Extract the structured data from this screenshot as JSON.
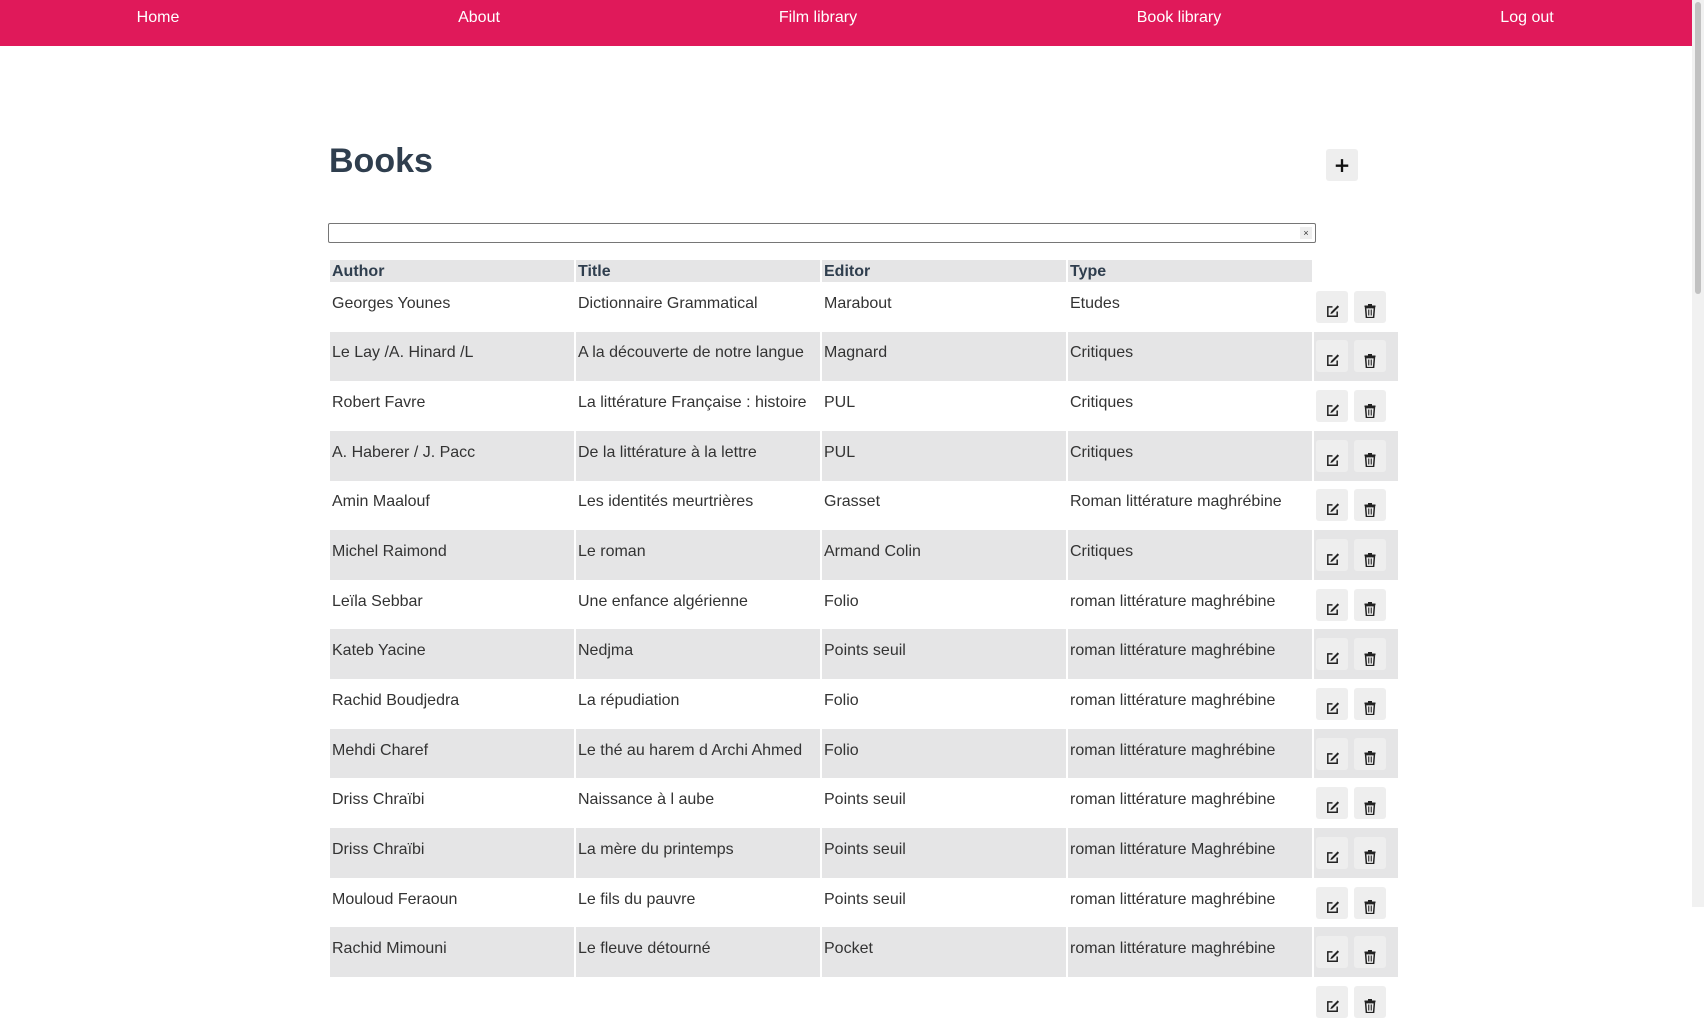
{
  "nav": {
    "items": [
      {
        "label": "Home"
      },
      {
        "label": "About"
      },
      {
        "label": "Film library"
      },
      {
        "label": "Book library"
      },
      {
        "label": "Log out"
      }
    ],
    "background_color": "#e0195a",
    "text_color": "#ffffff"
  },
  "page": {
    "title": "Books",
    "add_label": "+",
    "title_color": "#2f3e4e"
  },
  "search": {
    "value": "",
    "clear_label": "×"
  },
  "table": {
    "columns": [
      "Author",
      "Title",
      "Editor",
      "Type"
    ],
    "header_background": "#e5e5e6",
    "rows": [
      [
        "Georges Younes",
        "Dictionnaire Grammatical",
        "Marabout",
        "Etudes"
      ],
      [
        "Le Lay /A. Hinard /L",
        "A la découverte de notre langue",
        "Magnard",
        "Critiques"
      ],
      [
        "Robert Favre",
        "La littérature Française : histoire",
        "PUL",
        "Critiques"
      ],
      [
        "A. Haberer / J. Pacc",
        "De la littérature à la lettre",
        "PUL",
        "Critiques"
      ],
      [
        "Amin Maalouf",
        "Les identités meurtrières",
        "Grasset",
        "Roman littérature maghrébine"
      ],
      [
        "Michel Raimond",
        "Le roman",
        "Armand Colin",
        "Critiques"
      ],
      [
        "Leïla Sebbar",
        "Une enfance algérienne",
        "Folio",
        "roman littérature maghrébine"
      ],
      [
        "Kateb Yacine",
        "Nedjma",
        "Points seuil",
        "roman littérature maghrébine"
      ],
      [
        "Rachid Boudjedra",
        "La répudiation",
        "Folio",
        "roman littérature maghrébine"
      ],
      [
        "Mehdi Charef",
        "Le thé au harem d Archi Ahmed",
        "Folio",
        "roman littérature maghrébine"
      ],
      [
        "Driss Chraïbi",
        "Naissance à l aube",
        "Points seuil",
        "roman littérature maghrébine"
      ],
      [
        "Driss Chraïbi",
        "La mère du printemps",
        "Points seuil",
        "roman littérature Maghrébine"
      ],
      [
        "Mouloud Feraoun",
        "Le fils du pauvre",
        "Points seuil",
        "roman littérature maghrébine"
      ],
      [
        "Rachid Mimouni",
        "Le fleuve détourné",
        "Pocket",
        "roman littérature maghrébine"
      ],
      [
        "",
        "",
        "",
        ""
      ]
    ],
    "row_actions": [
      {
        "name": "edit",
        "icon": "edit-icon"
      },
      {
        "name": "delete",
        "icon": "trash-icon"
      }
    ]
  }
}
